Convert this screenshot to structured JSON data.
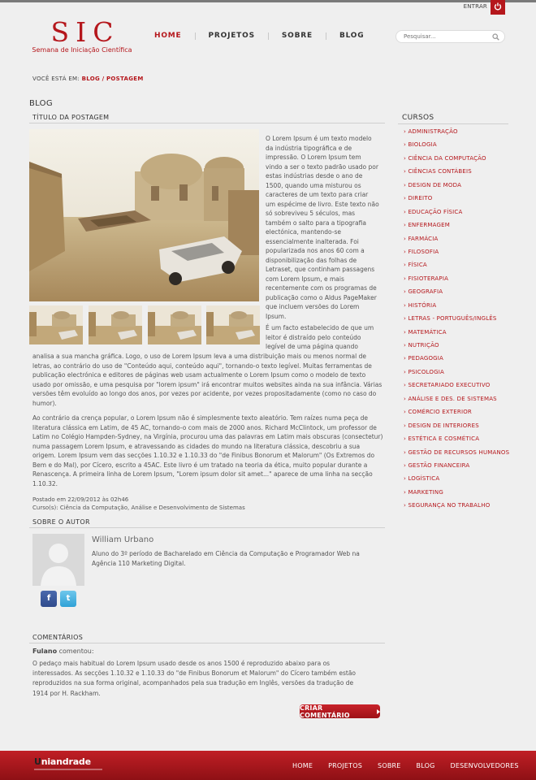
{
  "header": {
    "login_label": "ENTRAR",
    "logo_title": "SIC",
    "logo_subtitle": "Semana de Iniciação Científica",
    "nav": [
      "HOME",
      "PROJETOS",
      "SOBRE",
      "BLOG"
    ],
    "active_nav": "HOME",
    "search_placeholder": "Pesquisar...",
    "accent_color": "#b5171c"
  },
  "breadcrumb": {
    "prefix": "VOCÊ ESTÁ EM:",
    "blog": "BLOG",
    "separator": "/",
    "current": "POSTAGEM"
  },
  "page_title": "BLOG",
  "post": {
    "title": "TÍTULO DA POSTAGEM",
    "para1_side": "O Lorem Ipsum é um texto modelo da indústria tipográfica e de impressão. O Lorem Ipsum tem vindo a ser o texto padrão usado por estas indústrias desde o ano de 1500, quando uma misturou os caracteres de um texto para criar um espécime de livro. Este texto não só sobreviveu 5 séculos, mas também o salto para a tipografia electónica, mantendo-se essencialmente inalterada. Foi popularizada nos anos 60 com a disponibilização das folhas de Letraset, que continham passagens com Lorem Ipsum, e mais recentemente com os programas de publicação como o Aldus PageMaker que incluem versões do Lorem Ipsum.",
    "para2_side": "É um facto estabelecido de que um leitor é distraído pelo conteúdo legível de uma página quando",
    "para2_rest": "analisa a sua mancha gráfica. Logo, o uso de Lorem Ipsum leva a uma distribuição mais ou menos normal de letras, ao contrário do uso de \"Conteúdo aqui, conteúdo aqui\", tornando-o texto legível. Muitas ferramentas de publicação electrónica e editores de páginas web usam actualmente o Lorem Ipsum como o modelo de texto usado por omissão, e uma pesquisa por \"lorem ipsum\" irá encontrar muitos websites ainda na sua infância. Várias versões têm evoluído ao longo dos anos, por vezes por acidente, por vezes propositadamente (como no caso do humor).",
    "para3": "Ao contrário da crença popular, o Lorem Ipsum não é simplesmente texto aleatório. Tem raízes numa peça de literatura clássica em Latim, de 45 AC, tornando-o com mais de 2000 anos. Richard McClintock, um professor de Latim no Colégio Hampden-Sydney, na Virgínia, procurou uma das palavras em Latim mais obscuras (consectetur) numa passagem Lorem Ipsum, e atravessando as cidades do mundo na literatura clássica, descobriu a sua origem. Lorem Ipsum vem das secções 1.10.32 e 1.10.33 do \"de Finibus Bonorum et Malorum\" (Os Extremos do Bem e do Mal), por Cícero, escrito a 45AC. Este livro é um tratado na teoria da ética, muito popular durante a Renascença. A primeira linha de Lorem Ipsum, \"Lorem ipsum dolor sit amet...\" aparece de uma linha na secção 1.10.32.",
    "posted": "Postado em 22/09/2012 às 02h46",
    "courses": "Curso(s): Ciência da Computação, Análise e Desenvolvimento de Sistemas",
    "thumbnail_count": 4
  },
  "author": {
    "section_title": "SOBRE O AUTOR",
    "name": "William Urbano",
    "bio": "Aluno do 3º período de Bacharelado em Ciência da Computação e Programador Web na Agência 110 Marketing Digital.",
    "social": [
      "facebook-icon",
      "twitter-icon"
    ]
  },
  "comments": {
    "section_title": "COMENTÁRIOS",
    "author": "Fulano",
    "verb": "comentou:",
    "text": "O pedaço mais habitual do Lorem Ipsum usado desde os anos 1500 é reproduzido abaixo para os interessados. As secções 1.10.32 e 1.10.33 do \"de Finibus Bonorum et Malorum\" do Cícero também estão reproduzidos na sua forma original, acompanhados pela sua tradução em Inglês, versões da tradução de 1914 por H. Rackham.",
    "button": "CRIAR COMENTÁRIO"
  },
  "sidebar": {
    "title": "CURSOS",
    "items": [
      "ADMINISTRAÇÃO",
      "BIOLOGIA",
      "CIÊNCIA DA COMPUTAÇÃO",
      "CIÊNCIAS CONTÁBEIS",
      "DESIGN DE MODA",
      "DIREITO",
      "EDUCAÇÃO FÍSICA",
      "ENFERMAGEM",
      "FARMÁCIA",
      "FILOSOFIA",
      "FÍSICA",
      "FISIOTERAPIA",
      "GEOGRAFIA",
      "HISTÓRIA",
      "LETRAS - PORTUGUÊS/INGLÊS",
      "MATEMÁTICA",
      "NUTRIÇÃO",
      "PEDAGOGIA",
      "PSICOLOGIA",
      "SECRETARIADO EXECUTIVO",
      "ANÁLISE E DES. DE SISTEMAS",
      "COMÉRCIO EXTERIOR",
      "DESIGN DE INTERIORES",
      "ESTÉTICA E COSMÉTICA",
      "GESTÃO DE RECURSOS HUMANOS",
      "GESTÃO FINANCEIRA",
      "LOGÍSTICA",
      "MARKETING",
      "SEGURANÇA NO TRABALHO"
    ]
  },
  "footer": {
    "logo_prefix": "U",
    "logo_rest": "niandrade",
    "nav": [
      "HOME",
      "PROJETOS",
      "SOBRE",
      "BLOG",
      "DESENVOLVEDORES"
    ]
  }
}
